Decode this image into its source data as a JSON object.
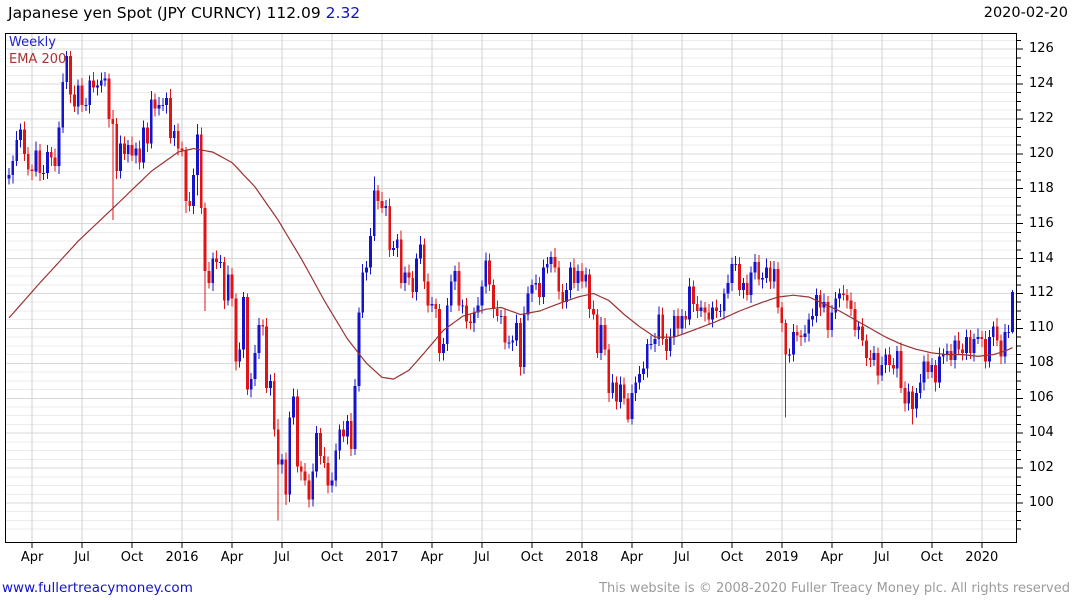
{
  "header": {
    "title": "Japanese yen Spot (JPY CURNCY) 112.09",
    "change": "2.32",
    "date": "2020-02-20"
  },
  "chart": {
    "timeframe": "Weekly",
    "ema_label": "EMA 200"
  },
  "footer": {
    "link": "www.fullertreacymoney.com",
    "copyright": "This website is © 2008-2020 Fuller Treacy Money plc. All rights reserved"
  },
  "chart_data": {
    "type": "candlestick",
    "title": "Japanese yen Spot (JPY CURNCY)",
    "timeframe": "Weekly",
    "overlay": "EMA 200",
    "last_price": 112.09,
    "change": 2.32,
    "as_of_date": "2020-02-20",
    "ylim": [
      97.71,
      126.92
    ],
    "y_ticks": [
      100,
      102,
      104,
      106,
      108,
      110,
      112,
      114,
      116,
      118,
      120,
      122,
      124,
      126
    ],
    "x_ticks": [
      [
        6,
        "Apr"
      ],
      [
        19,
        "Jul"
      ],
      [
        32,
        "Oct"
      ],
      [
        45,
        "2016"
      ],
      [
        58,
        "Apr"
      ],
      [
        71,
        "Jul"
      ],
      [
        84,
        "Oct"
      ],
      [
        97,
        "2017"
      ],
      [
        110,
        "Apr"
      ],
      [
        123,
        "Jul"
      ],
      [
        136,
        "Oct"
      ],
      [
        149,
        "2018"
      ],
      [
        162,
        "Apr"
      ],
      [
        175,
        "Jul"
      ],
      [
        188,
        "Oct"
      ],
      [
        201,
        "2019"
      ],
      [
        214,
        "Apr"
      ],
      [
        227,
        "Jul"
      ],
      [
        240,
        "Oct"
      ],
      [
        253,
        "2020"
      ]
    ],
    "first_open": 118.6,
    "closes": [
      118.8,
      119.6,
      120.8,
      121.4,
      120.0,
      119.1,
      119.0,
      120.2,
      118.9,
      118.9,
      120.1,
      119.8,
      119.3,
      121.5,
      124.1,
      125.6,
      123.4,
      122.7,
      123.9,
      122.8,
      122.8,
      124.2,
      123.8,
      123.9,
      124.2,
      124.3,
      122.0,
      121.7,
      119.0,
      120.6,
      120.0,
      120.5,
      119.9,
      120.3,
      119.5,
      121.5,
      120.6,
      123.1,
      122.6,
      122.8,
      122.8,
      123.2,
      120.9,
      121.3,
      120.3,
      120.2,
      117.3,
      117.0,
      118.8,
      121.1,
      116.9,
      113.3,
      112.6,
      114.0,
      113.8,
      113.8,
      111.6,
      113.1,
      111.7,
      108.1,
      108.8,
      111.8,
      106.5,
      107.1,
      108.6,
      110.2,
      110.1,
      106.6,
      107.0,
      104.2,
      102.2,
      102.5,
      100.5,
      104.9,
      106.1,
      102.1,
      101.8,
      101.3,
      100.2,
      101.8,
      104.0,
      102.7,
      102.3,
      101.0,
      101.3,
      103.0,
      104.2,
      103.8,
      104.7,
      103.1,
      106.7,
      110.9,
      113.2,
      113.5,
      115.3,
      117.9,
      117.3,
      116.9,
      117.0,
      114.5,
      114.6,
      115.1,
      112.6,
      113.2,
      112.9,
      112.1,
      114.0,
      114.8,
      112.7,
      111.3,
      111.4,
      111.1,
      108.6,
      109.1,
      111.3,
      112.7,
      113.3,
      111.3,
      111.3,
      110.4,
      110.3,
      110.9,
      111.3,
      112.4,
      113.9,
      112.5,
      111.1,
      110.7,
      110.7,
      109.2,
      109.2,
      109.3,
      110.3,
      107.8,
      110.8,
      112.0,
      112.5,
      112.6,
      111.8,
      113.5,
      113.7,
      114.1,
      113.5,
      112.1,
      111.5,
      112.2,
      113.5,
      112.6,
      113.3,
      112.7,
      113.1,
      111.1,
      110.8,
      108.6,
      110.2,
      108.8,
      106.3,
      106.9,
      105.8,
      106.8,
      106.0,
      104.8,
      106.3,
      106.9,
      107.4,
      107.7,
      109.1,
      109.1,
      109.4,
      110.8,
      109.4,
      108.7,
      109.5,
      110.7,
      110.0,
      110.7,
      110.5,
      112.4,
      111.4,
      111.0,
      111.2,
      110.9,
      110.5,
      111.2,
      111.0,
      111.0,
      112.0,
      112.6,
      113.7,
      113.7,
      112.2,
      112.6,
      111.9,
      113.2,
      113.8,
      112.8,
      112.9,
      113.5,
      112.7,
      113.4,
      111.2,
      110.3,
      108.5,
      108.5,
      109.8,
      109.6,
      109.5,
      109.7,
      110.5,
      110.7,
      111.9,
      111.2,
      111.5,
      109.9,
      110.9,
      111.7,
      112.0,
      111.9,
      111.6,
      111.1,
      109.9,
      110.1,
      109.3,
      108.3,
      108.2,
      108.6,
      107.3,
      107.9,
      108.5,
      107.9,
      107.7,
      108.7,
      106.6,
      105.7,
      106.4,
      105.4,
      106.3,
      106.9,
      108.1,
      107.5,
      107.9,
      106.9,
      108.4,
      108.5,
      108.7,
      108.2,
      109.3,
      108.8,
      108.6,
      109.5,
      108.6,
      109.4,
      109.5,
      109.4,
      108.1,
      109.5,
      110.1,
      109.3,
      108.4,
      109.8,
      109.8,
      112.1
    ],
    "high_pads": [
      0.4,
      0.3,
      0.5,
      0.35,
      0.45
    ],
    "low_pads": [
      0.35,
      0.5,
      0.3,
      0.45,
      0.4
    ],
    "overrides": {
      "14": [
        121.5,
        124.6,
        121.2,
        124.1
      ],
      "15": [
        124.1,
        125.9,
        123.7,
        125.6
      ],
      "27": [
        122.0,
        122.5,
        116.2,
        121.7
      ],
      "46": [
        120.2,
        120.4,
        116.6,
        117.3
      ],
      "49": [
        118.8,
        121.7,
        117.6,
        121.1
      ],
      "51": [
        116.9,
        117.2,
        111.0,
        113.3
      ],
      "59": [
        111.7,
        112.0,
        107.6,
        108.1
      ],
      "62": [
        111.8,
        112.0,
        106.2,
        106.5
      ],
      "70": [
        104.2,
        104.8,
        99.0,
        102.2
      ],
      "72": [
        102.5,
        102.9,
        99.9,
        100.5
      ],
      "91": [
        106.7,
        111.2,
        106.4,
        110.9
      ],
      "95": [
        115.3,
        118.7,
        115.0,
        117.9
      ],
      "112": [
        111.1,
        111.4,
        108.1,
        108.6
      ],
      "133": [
        110.3,
        110.6,
        107.3,
        107.8
      ],
      "153": [
        110.8,
        111.1,
        108.3,
        108.6
      ],
      "161": [
        106.0,
        106.3,
        104.6,
        104.8
      ],
      "202": [
        110.3,
        110.5,
        104.9,
        108.5
      ],
      "235": [
        106.4,
        106.7,
        104.5,
        105.4
      ],
      "261": [
        109.8,
        112.2,
        109.7,
        112.1
      ]
    },
    "ema": [
      [
        0,
        110.6
      ],
      [
        8,
        112.6
      ],
      [
        18,
        115.0
      ],
      [
        29,
        117.3
      ],
      [
        37,
        119.0
      ],
      [
        44,
        120.1
      ],
      [
        48,
        120.3
      ],
      [
        53,
        120.1
      ],
      [
        58,
        119.5
      ],
      [
        64,
        118.1
      ],
      [
        70,
        116.2
      ],
      [
        76,
        114.0
      ],
      [
        82,
        111.6
      ],
      [
        88,
        109.4
      ],
      [
        93,
        108.0
      ],
      [
        97,
        107.2
      ],
      [
        100,
        107.1
      ],
      [
        104,
        107.6
      ],
      [
        108,
        108.6
      ],
      [
        113,
        109.9
      ],
      [
        118,
        110.7
      ],
      [
        124,
        111.1
      ],
      [
        128,
        111.2
      ],
      [
        133,
        110.8
      ],
      [
        138,
        111.0
      ],
      [
        144,
        111.5
      ],
      [
        148,
        111.8
      ],
      [
        152,
        112.0
      ],
      [
        156,
        111.6
      ],
      [
        160,
        110.8
      ],
      [
        164,
        110.1
      ],
      [
        168,
        109.5
      ],
      [
        173,
        109.5
      ],
      [
        178,
        109.9
      ],
      [
        184,
        110.4
      ],
      [
        190,
        111.0
      ],
      [
        196,
        111.5
      ],
      [
        200,
        111.8
      ],
      [
        204,
        111.9
      ],
      [
        208,
        111.8
      ],
      [
        212,
        111.4
      ],
      [
        216,
        111.0
      ],
      [
        220,
        110.5
      ],
      [
        224,
        110.0
      ],
      [
        228,
        109.5
      ],
      [
        232,
        109.1
      ],
      [
        236,
        108.8
      ],
      [
        240,
        108.6
      ],
      [
        244,
        108.5
      ],
      [
        248,
        108.5
      ],
      [
        252,
        108.4
      ],
      [
        256,
        108.5
      ],
      [
        259,
        108.7
      ],
      [
        261,
        108.9
      ]
    ],
    "colors": {
      "up": "#1414cc",
      "down": "#e01414",
      "ema": "#993333",
      "grid_minor": "#ebebeb",
      "grid_major": "#d8d8d8",
      "grid_vert": "#d2d2d2",
      "frame": "#000000",
      "accent_blue": "#0f0fcd",
      "legend_blue": "#2222cc",
      "legend_ema": "#aa3333"
    },
    "legend_position": "top-left",
    "grid": true
  }
}
